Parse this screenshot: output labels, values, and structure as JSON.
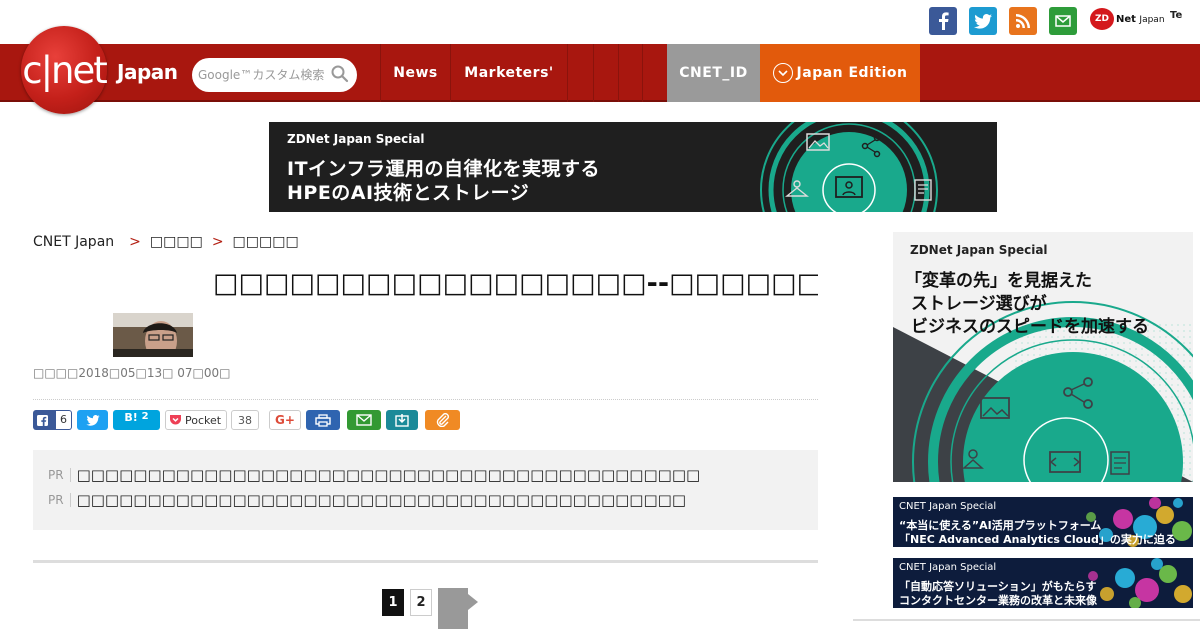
{
  "social": {
    "icons": [
      "facebook-icon",
      "twitter-icon",
      "rss-icon",
      "mail-icon"
    ],
    "zdnet_label": "Net",
    "zdnet_small": "Japan",
    "zdnet_mark": "ZD",
    "te_label": "Te"
  },
  "header": {
    "logo_text": "c|net",
    "logo_sub": "Japan",
    "search_placeholder": "Google™カスタム検索",
    "nav": [
      {
        "label": "News"
      },
      {
        "label": "Marketers'"
      },
      {
        "label": ""
      },
      {
        "label": ""
      },
      {
        "label": ""
      },
      {
        "label": "CNET_ID"
      },
      {
        "label": "Japan Edition"
      }
    ]
  },
  "banner": {
    "label": "ZDNet Japan Special",
    "line1": "ITインフラ運用の自律化を実現する",
    "line2": "HPEのAI技術とストレージ"
  },
  "breadcrumb": {
    "home": "CNET Japan",
    "sep": ">",
    "level1": "□□□□",
    "level2": "□□□□□"
  },
  "article": {
    "title": "□□□□□□□□□□□□□□□□□--□□□□□□□□□□□□□□□□□□□□",
    "meta": "□□□□2018□05□13□ 07□00□"
  },
  "share": {
    "fb_count": "6",
    "hatena_label": "B!",
    "hatena_count": "2",
    "pocket_label": "Pocket",
    "pocket_count": "38",
    "gplus_label": "G+"
  },
  "pr": {
    "tag": "PR",
    "items": [
      "□□□□□□□□□□□□□□□□□□□□□□□□□□□□□□□□□□□□□□□□□□□□",
      "□□□□□□□□□□□□□□□□□□□□□□□□□□□□□□□□□□□□□□□□□□□"
    ]
  },
  "pagination": {
    "current": "1",
    "next_page": "2"
  },
  "sidebar": {
    "ad1": {
      "label": "ZDNet Japan Special",
      "line1": "「変革の先」を見据えた",
      "line2": "ストレージ選びが",
      "line3": "ビジネスのスピードを加速する"
    },
    "ad2": {
      "label": "CNET Japan Special",
      "line1": "“本当に使える”AI活用プラットフォーム",
      "line2": "「NEC Advanced Analytics Cloud」の実力に迫る"
    },
    "ad3": {
      "label": "CNET Japan Special",
      "line1": "「自動応答ソリューション」がもたらす",
      "line2": "コンタクトセンター業務の改革と未来像"
    }
  },
  "colors": {
    "nav_red": "#a8170f",
    "cnet_id_gray": "#9a9a9a",
    "edition_orange": "#e25a0c",
    "teal": "#19a98c"
  }
}
